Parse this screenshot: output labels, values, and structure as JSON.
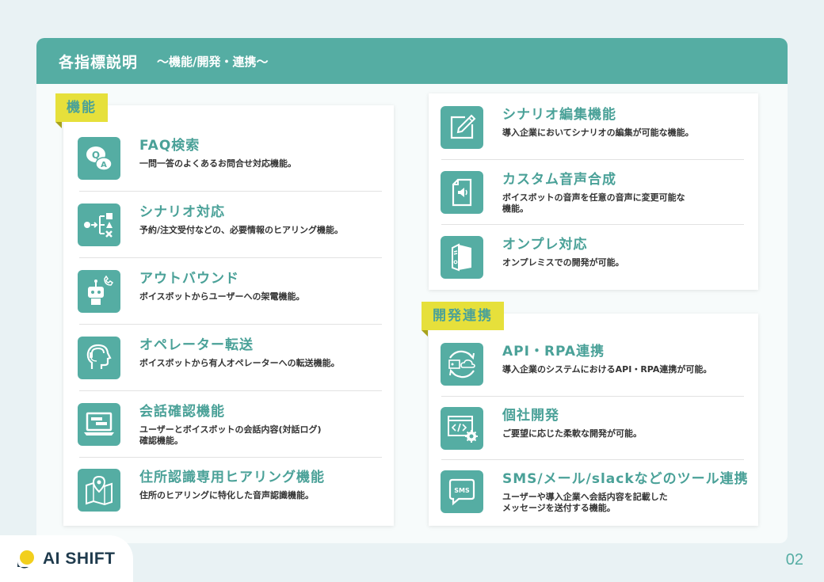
{
  "header": {
    "title": "各指標説明",
    "subtitle": "〜機能/開発・連携〜"
  },
  "left": {
    "tag": "機能",
    "items": [
      {
        "title": "FAQ検索",
        "desc": "一問一答のよくあるお問合せ対応機能。",
        "icon": "qa-bubbles-icon"
      },
      {
        "title": "シナリオ対応",
        "desc": "予約/注文受付などの、必要情報のヒアリング機能。",
        "icon": "flow-branch-icon"
      },
      {
        "title": "アウトバウンド",
        "desc": "ボイスボットからユーザーへの架電機能。",
        "icon": "robot-phone-icon"
      },
      {
        "title": "オペレーター転送",
        "desc": "ボイスボットから有人オペレーターへの転送機能。",
        "icon": "operator-headset-icon"
      },
      {
        "title": "会話確認機能",
        "desc": "ユーザーとボイスボットの会話内容(対話ログ)\n確認機能。",
        "icon": "laptop-chat-icon"
      },
      {
        "title": "住所認識専用ヒアリング機能",
        "desc": "住所のヒアリングに特化した音声認識機能。",
        "icon": "map-pin-icon"
      }
    ]
  },
  "right_top": {
    "items": [
      {
        "title": "シナリオ編集機能",
        "desc": "導入企業においてシナリオの編集が可能な機能。",
        "icon": "edit-pen-icon"
      },
      {
        "title": "カスタム音声合成",
        "desc": "ボイスボットの音声を任意の音声に変更可能な\n機能。",
        "icon": "audio-file-icon"
      },
      {
        "title": "オンプレ対応",
        "desc": "オンプレミスでの開発が可能。",
        "icon": "server-icon"
      }
    ]
  },
  "right_bottom": {
    "tag": "開発連携",
    "items": [
      {
        "title": "API・RPA連携",
        "desc": "導入企業のシステムにおけるAPI・RPA連携が可能。",
        "icon": "cloud-sync-icon"
      },
      {
        "title": "個社開発",
        "desc": "ご要望に応じた柔軟な開発が可能。",
        "icon": "code-gear-icon"
      },
      {
        "title": "SMS/メール/slackなどのツール連携",
        "desc": "ユーザーや導入企業へ会話内容を記載した\nメッセージを送付する機能。",
        "icon": "sms-bubble-icon"
      }
    ]
  },
  "footer": {
    "logo": "AI SHIFT",
    "page": "02"
  },
  "colors": {
    "accent": "#55ada3",
    "tag": "#e6e03b",
    "logo_yellow": "#f2cf1d",
    "logo_navy": "#1f3b4d"
  }
}
